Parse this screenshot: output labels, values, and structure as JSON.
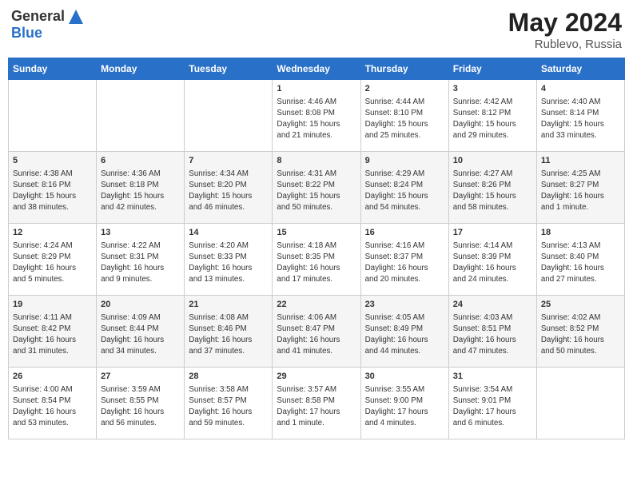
{
  "header": {
    "logo_general": "General",
    "logo_blue": "Blue",
    "month_year": "May 2024",
    "location": "Rublevo, Russia"
  },
  "days_of_week": [
    "Sunday",
    "Monday",
    "Tuesday",
    "Wednesday",
    "Thursday",
    "Friday",
    "Saturday"
  ],
  "weeks": [
    [
      {
        "day": "",
        "info": ""
      },
      {
        "day": "",
        "info": ""
      },
      {
        "day": "",
        "info": ""
      },
      {
        "day": "1",
        "info": "Sunrise: 4:46 AM\nSunset: 8:08 PM\nDaylight: 15 hours\nand 21 minutes."
      },
      {
        "day": "2",
        "info": "Sunrise: 4:44 AM\nSunset: 8:10 PM\nDaylight: 15 hours\nand 25 minutes."
      },
      {
        "day": "3",
        "info": "Sunrise: 4:42 AM\nSunset: 8:12 PM\nDaylight: 15 hours\nand 29 minutes."
      },
      {
        "day": "4",
        "info": "Sunrise: 4:40 AM\nSunset: 8:14 PM\nDaylight: 15 hours\nand 33 minutes."
      }
    ],
    [
      {
        "day": "5",
        "info": "Sunrise: 4:38 AM\nSunset: 8:16 PM\nDaylight: 15 hours\nand 38 minutes."
      },
      {
        "day": "6",
        "info": "Sunrise: 4:36 AM\nSunset: 8:18 PM\nDaylight: 15 hours\nand 42 minutes."
      },
      {
        "day": "7",
        "info": "Sunrise: 4:34 AM\nSunset: 8:20 PM\nDaylight: 15 hours\nand 46 minutes."
      },
      {
        "day": "8",
        "info": "Sunrise: 4:31 AM\nSunset: 8:22 PM\nDaylight: 15 hours\nand 50 minutes."
      },
      {
        "day": "9",
        "info": "Sunrise: 4:29 AM\nSunset: 8:24 PM\nDaylight: 15 hours\nand 54 minutes."
      },
      {
        "day": "10",
        "info": "Sunrise: 4:27 AM\nSunset: 8:26 PM\nDaylight: 15 hours\nand 58 minutes."
      },
      {
        "day": "11",
        "info": "Sunrise: 4:25 AM\nSunset: 8:27 PM\nDaylight: 16 hours\nand 1 minute."
      }
    ],
    [
      {
        "day": "12",
        "info": "Sunrise: 4:24 AM\nSunset: 8:29 PM\nDaylight: 16 hours\nand 5 minutes."
      },
      {
        "day": "13",
        "info": "Sunrise: 4:22 AM\nSunset: 8:31 PM\nDaylight: 16 hours\nand 9 minutes."
      },
      {
        "day": "14",
        "info": "Sunrise: 4:20 AM\nSunset: 8:33 PM\nDaylight: 16 hours\nand 13 minutes."
      },
      {
        "day": "15",
        "info": "Sunrise: 4:18 AM\nSunset: 8:35 PM\nDaylight: 16 hours\nand 17 minutes."
      },
      {
        "day": "16",
        "info": "Sunrise: 4:16 AM\nSunset: 8:37 PM\nDaylight: 16 hours\nand 20 minutes."
      },
      {
        "day": "17",
        "info": "Sunrise: 4:14 AM\nSunset: 8:39 PM\nDaylight: 16 hours\nand 24 minutes."
      },
      {
        "day": "18",
        "info": "Sunrise: 4:13 AM\nSunset: 8:40 PM\nDaylight: 16 hours\nand 27 minutes."
      }
    ],
    [
      {
        "day": "19",
        "info": "Sunrise: 4:11 AM\nSunset: 8:42 PM\nDaylight: 16 hours\nand 31 minutes."
      },
      {
        "day": "20",
        "info": "Sunrise: 4:09 AM\nSunset: 8:44 PM\nDaylight: 16 hours\nand 34 minutes."
      },
      {
        "day": "21",
        "info": "Sunrise: 4:08 AM\nSunset: 8:46 PM\nDaylight: 16 hours\nand 37 minutes."
      },
      {
        "day": "22",
        "info": "Sunrise: 4:06 AM\nSunset: 8:47 PM\nDaylight: 16 hours\nand 41 minutes."
      },
      {
        "day": "23",
        "info": "Sunrise: 4:05 AM\nSunset: 8:49 PM\nDaylight: 16 hours\nand 44 minutes."
      },
      {
        "day": "24",
        "info": "Sunrise: 4:03 AM\nSunset: 8:51 PM\nDaylight: 16 hours\nand 47 minutes."
      },
      {
        "day": "25",
        "info": "Sunrise: 4:02 AM\nSunset: 8:52 PM\nDaylight: 16 hours\nand 50 minutes."
      }
    ],
    [
      {
        "day": "26",
        "info": "Sunrise: 4:00 AM\nSunset: 8:54 PM\nDaylight: 16 hours\nand 53 minutes."
      },
      {
        "day": "27",
        "info": "Sunrise: 3:59 AM\nSunset: 8:55 PM\nDaylight: 16 hours\nand 56 minutes."
      },
      {
        "day": "28",
        "info": "Sunrise: 3:58 AM\nSunset: 8:57 PM\nDaylight: 16 hours\nand 59 minutes."
      },
      {
        "day": "29",
        "info": "Sunrise: 3:57 AM\nSunset: 8:58 PM\nDaylight: 17 hours\nand 1 minute."
      },
      {
        "day": "30",
        "info": "Sunrise: 3:55 AM\nSunset: 9:00 PM\nDaylight: 17 hours\nand 4 minutes."
      },
      {
        "day": "31",
        "info": "Sunrise: 3:54 AM\nSunset: 9:01 PM\nDaylight: 17 hours\nand 6 minutes."
      },
      {
        "day": "",
        "info": ""
      }
    ]
  ]
}
